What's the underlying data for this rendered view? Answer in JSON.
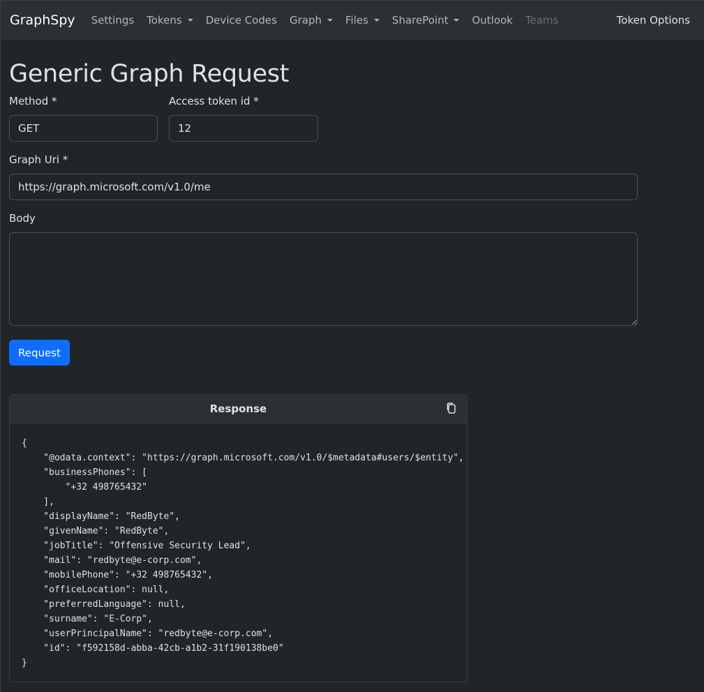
{
  "navbar": {
    "brand": "GraphSpy",
    "items": [
      {
        "label": "Settings",
        "dropdown": false,
        "disabled": false
      },
      {
        "label": "Tokens",
        "dropdown": true,
        "disabled": false
      },
      {
        "label": "Device Codes",
        "dropdown": false,
        "disabled": false
      },
      {
        "label": "Graph",
        "dropdown": true,
        "disabled": false
      },
      {
        "label": "Files",
        "dropdown": true,
        "disabled": false
      },
      {
        "label": "SharePoint",
        "dropdown": true,
        "disabled": false
      },
      {
        "label": "Outlook",
        "dropdown": false,
        "disabled": false
      },
      {
        "label": "Teams",
        "dropdown": false,
        "disabled": true
      }
    ],
    "right_item": "Token Options"
  },
  "page": {
    "title": "Generic Graph Request"
  },
  "form": {
    "method_label": "Method *",
    "method_value": "GET",
    "token_label": "Access token id *",
    "token_value": "12",
    "uri_label": "Graph Uri *",
    "uri_value": "https://graph.microsoft.com/v1.0/me",
    "body_label": "Body",
    "body_value": "",
    "submit_label": "Request"
  },
  "response": {
    "title": "Response",
    "copy_icon": "copy-icon",
    "content": "{\n    \"@odata.context\": \"https://graph.microsoft.com/v1.0/$metadata#users/$entity\",\n    \"businessPhones\": [\n        \"+32 498765432\"\n    ],\n    \"displayName\": \"RedByte\",\n    \"givenName\": \"RedByte\",\n    \"jobTitle\": \"Offensive Security Lead\",\n    \"mail\": \"redbyte@e-corp.com\",\n    \"mobilePhone\": \"+32 498765432\",\n    \"officeLocation\": null,\n    \"preferredLanguage\": null,\n    \"surname\": \"E-Corp\",\n    \"userPrincipalName\": \"redbyte@e-corp.com\",\n    \"id\": \"f592158d-abba-42cb-a1b2-31f190138be0\"\n}"
  }
}
